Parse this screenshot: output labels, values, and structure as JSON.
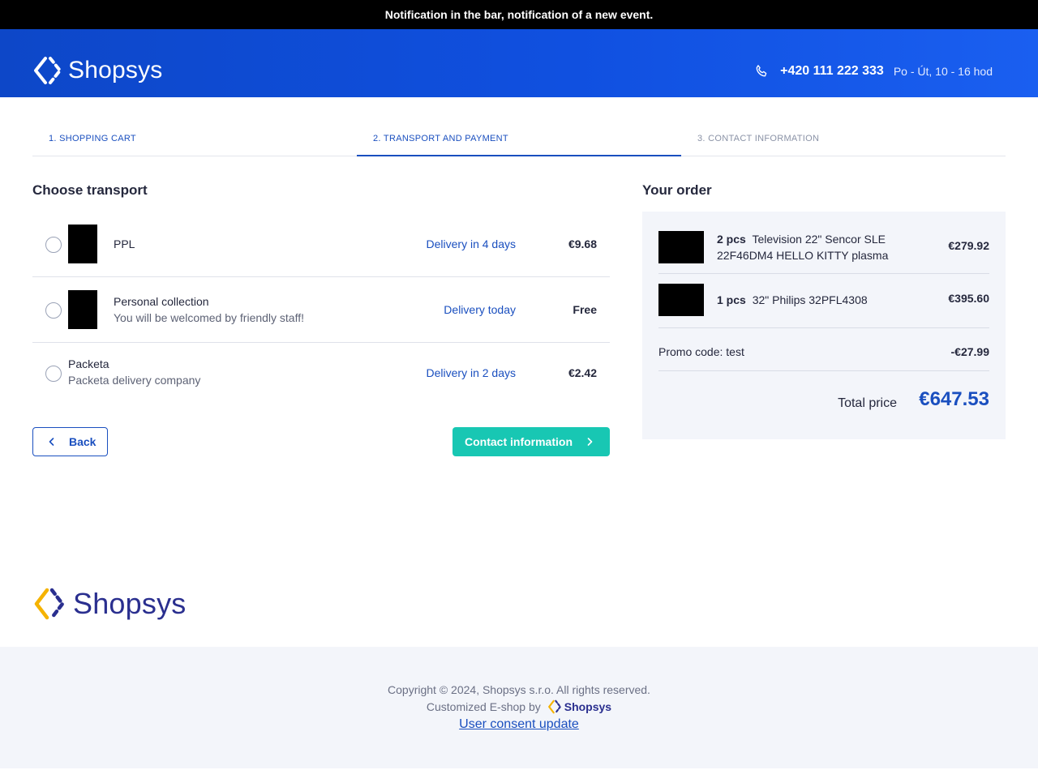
{
  "notification": {
    "text": "Notification in the bar, notification of a new event."
  },
  "header": {
    "logo_text": "Shopsys",
    "phone": "+420 111 222 333",
    "hours": "Po - Út, 10 - 16 hod",
    "icons": [
      "shopsys-logo-icon",
      "phone-icon"
    ],
    "background_color": "#1050e0"
  },
  "steps": [
    {
      "label": "1. SHOPPING CART",
      "state": "done"
    },
    {
      "label": "2. TRANSPORT AND PAYMENT",
      "state": "active"
    },
    {
      "label": "3. CONTACT INFORMATION",
      "state": "todo"
    }
  ],
  "transport": {
    "title": "Choose transport",
    "options": [
      {
        "name": "PPL",
        "description": "",
        "delivery": "Delivery in 4 days",
        "price": "€9.68",
        "selected": false
      },
      {
        "name": "Personal collection",
        "description": "You will be welcomed by friendly staff!",
        "delivery": "Delivery today",
        "price": "Free",
        "selected": false
      },
      {
        "name": "Packeta",
        "description": "Packeta delivery company",
        "delivery": "Delivery in 2 days",
        "price": "€2.42",
        "selected": false
      }
    ]
  },
  "buttons": {
    "back": "Back",
    "next": "Contact information"
  },
  "order": {
    "title": "Your order",
    "items": [
      {
        "qty": "2 pcs",
        "name": "Television 22\" Sencor SLE 22F46DM4 HELLO KITTY plasma",
        "price": "€279.92"
      },
      {
        "qty": "1 pcs",
        "name": "32\" Philips 32PFL4308",
        "price": "€395.60"
      }
    ],
    "promo_label": "Promo code: test",
    "promo_value": "-€27.99",
    "total_label": "Total price",
    "total_value": "€647.53"
  },
  "footer": {
    "logo_text": "Shopsys",
    "copyright": "Copyright © 2024, Shopsys s.r.o. All rights reserved.",
    "customized": "Customized E-shop by",
    "customized_logo": "Shopsys",
    "consent_link": "User consent update"
  },
  "colors": {
    "accent_blue": "#1a4fbf",
    "teal_button": "#18c7b3",
    "logo_yellow": "#f5b300",
    "logo_indigo": "#2a2f8f"
  }
}
